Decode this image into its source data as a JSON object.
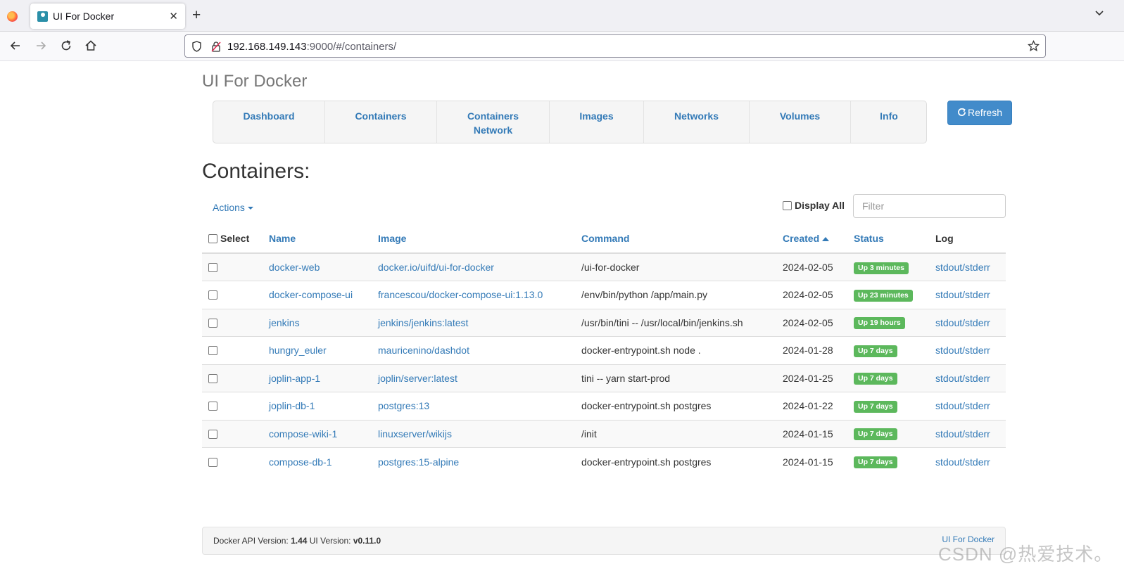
{
  "browser": {
    "tab_title": "UI For Docker",
    "url_host": "192.168.149.143",
    "url_rest": ":9000/#/containers/"
  },
  "app": {
    "brand": "UI For Docker",
    "nav": [
      {
        "label": "Dashboard"
      },
      {
        "label": "Containers"
      },
      {
        "label": "Containers Network"
      },
      {
        "label": "Images"
      },
      {
        "label": "Networks"
      },
      {
        "label": "Volumes"
      },
      {
        "label": "Info"
      }
    ],
    "refresh_label": "Refresh",
    "page_title": "Containers:",
    "actions_label": "Actions",
    "display_all_label": "Display All",
    "filter_placeholder": "Filter",
    "columns": {
      "select": "Select",
      "name": "Name",
      "image": "Image",
      "command": "Command",
      "created": "Created",
      "status": "Status",
      "log": "Log"
    },
    "rows": [
      {
        "name": "docker-web",
        "image": "docker.io/uifd/ui-for-docker",
        "command": "/ui-for-docker",
        "created": "2024-02-05",
        "status": "Up 3 minutes",
        "log": "stdout/stderr"
      },
      {
        "name": "docker-compose-ui",
        "image": "francescou/docker-compose-ui:1.13.0",
        "command": "/env/bin/python /app/main.py",
        "created": "2024-02-05",
        "status": "Up 23 minutes",
        "log": "stdout/stderr"
      },
      {
        "name": "jenkins",
        "image": "jenkins/jenkins:latest",
        "command": "/usr/bin/tini -- /usr/local/bin/jenkins.sh",
        "created": "2024-02-05",
        "status": "Up 19 hours",
        "log": "stdout/stderr"
      },
      {
        "name": "hungry_euler",
        "image": "mauricenino/dashdot",
        "command": "docker-entrypoint.sh node .",
        "created": "2024-01-28",
        "status": "Up 7 days",
        "log": "stdout/stderr"
      },
      {
        "name": "joplin-app-1",
        "image": "joplin/server:latest",
        "command": "tini -- yarn start-prod",
        "created": "2024-01-25",
        "status": "Up 7 days",
        "log": "stdout/stderr"
      },
      {
        "name": "joplin-db-1",
        "image": "postgres:13",
        "command": "docker-entrypoint.sh postgres",
        "created": "2024-01-22",
        "status": "Up 7 days",
        "log": "stdout/stderr"
      },
      {
        "name": "compose-wiki-1",
        "image": "linuxserver/wikijs",
        "command": "/init",
        "created": "2024-01-15",
        "status": "Up 7 days",
        "log": "stdout/stderr"
      },
      {
        "name": "compose-db-1",
        "image": "postgres:15-alpine",
        "command": "docker-entrypoint.sh postgres",
        "created": "2024-01-15",
        "status": "Up 7 days",
        "log": "stdout/stderr"
      }
    ],
    "footer": {
      "api_label": "Docker API Version:",
      "api_version": "1.44",
      "ui_label": "UI Version:",
      "ui_version": "v0.11.0",
      "link": "UI For Docker"
    }
  },
  "watermark": "CSDN @热爱技术。",
  "colors": {
    "link": "#337ab7",
    "primary_button": "#428bca",
    "status_up": "#5cb85c"
  }
}
